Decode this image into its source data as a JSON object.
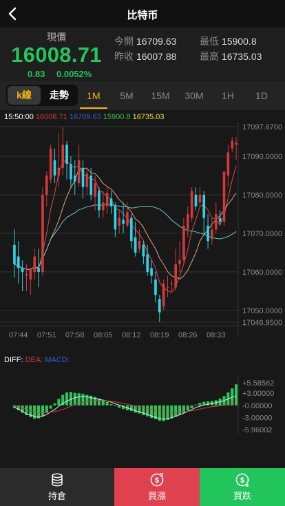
{
  "header": {
    "title": "比特币"
  },
  "quote": {
    "price_label": "現價",
    "price": "16008.71",
    "change": "0.83",
    "change_pct": "0.0052%",
    "stats": [
      {
        "label": "今開",
        "value": "16709.63"
      },
      {
        "label": "最低",
        "value": "15900.8"
      },
      {
        "label": "昨收",
        "value": "16007.88"
      },
      {
        "label": "最高",
        "value": "16735.03"
      }
    ],
    "up_color": "#27c45d"
  },
  "tabs": {
    "kline": "k線",
    "trend": "走勢",
    "intervals": [
      "1M",
      "5M",
      "15M",
      "30M",
      "1H",
      "1D"
    ],
    "active": "1M"
  },
  "candle_info": {
    "time": "15:50:00",
    "close": "16008.71",
    "open": "16709.63",
    "low": "15900.8",
    "high": "16735.03"
  },
  "chart_data": {
    "type": "candlestick",
    "y_ticks": [
      "17097.6700",
      "17090.0000",
      "17080.0000",
      "17070.0000",
      "17060.0000",
      "17050.0000",
      "17046.9500"
    ],
    "ylim": [
      17046.95,
      17097.67
    ],
    "x_ticks": [
      "07:44",
      "07:51",
      "07:58",
      "08:05",
      "08:12",
      "08:19",
      "08:26",
      "08:33"
    ],
    "colors": {
      "up": "#d03a3a",
      "down": "#2ed3e6",
      "ma5": "#d84d4d",
      "ma10": "#e8a07a",
      "ma30": "#6fc3d0"
    },
    "candles": [
      [
        17067.0,
        17062.0,
        17058.5,
        17071.0
      ],
      [
        17064.0,
        17061.0,
        17057.0,
        17068.0
      ],
      [
        17061.0,
        17060.0,
        17055.0,
        17063.0
      ],
      [
        17059.0,
        17059.5,
        17055.0,
        17062.0
      ],
      [
        17058.0,
        17061.0,
        17054.0,
        17061.0
      ],
      [
        17060.0,
        17064.0,
        17058.0,
        17066.0
      ],
      [
        17061.0,
        17060.0,
        17056.0,
        17066.0
      ],
      [
        17060.0,
        17080.0,
        17059.0,
        17082.0
      ],
      [
        17080.0,
        17085.0,
        17077.0,
        17086.0
      ],
      [
        17084.0,
        17092.0,
        17083.0,
        17093.0
      ],
      [
        17089.0,
        17085.0,
        17083.0,
        17092.0
      ],
      [
        17085.0,
        17087.0,
        17082.0,
        17096.0
      ],
      [
        17087.0,
        17093.0,
        17085.0,
        17097.5
      ],
      [
        17093.0,
        17088.0,
        17084.0,
        17094.0
      ],
      [
        17088.0,
        17084.0,
        17082.0,
        17090.0
      ],
      [
        17085.0,
        17083.5,
        17080.0,
        17089.0
      ],
      [
        17083.0,
        17089.0,
        17082.0,
        17093.0
      ],
      [
        17087.0,
        17082.0,
        17079.0,
        17089.0
      ],
      [
        17082.0,
        17085.5,
        17080.0,
        17087.0
      ],
      [
        17085.0,
        17080.0,
        17078.5,
        17087.0
      ],
      [
        17079.5,
        17083.0,
        17076.0,
        17085.0
      ],
      [
        17081.0,
        17076.0,
        17074.0,
        17082.0
      ],
      [
        17076.0,
        17078.0,
        17074.0,
        17081.0
      ],
      [
        17077.0,
        17080.5,
        17075.0,
        17082.0
      ],
      [
        17079.0,
        17077.0,
        17075.0,
        17081.0
      ],
      [
        17077.0,
        17071.0,
        17069.0,
        17078.0
      ],
      [
        17072.0,
        17074.0,
        17070.0,
        17076.0
      ],
      [
        17073.5,
        17072.5,
        17070.0,
        17078.0
      ],
      [
        17072.0,
        17075.5,
        17071.5,
        17078.0
      ],
      [
        17074.0,
        17068.0,
        17066.0,
        17075.0
      ],
      [
        17069.0,
        17065.0,
        17064.0,
        17073.0
      ],
      [
        17066.0,
        17068.0,
        17065.0,
        17071.0
      ],
      [
        17067.0,
        17064.0,
        17062.0,
        17068.0
      ],
      [
        17064.5,
        17060.0,
        17059.0,
        17067.0
      ],
      [
        17061.0,
        17059.0,
        17057.0,
        17063.0
      ],
      [
        17058.0,
        17054.0,
        17052.0,
        17060.0
      ],
      [
        17053.0,
        17049.5,
        17047.0,
        17054.0
      ],
      [
        17051.0,
        17057.0,
        17050.0,
        17058.0
      ],
      [
        17056.0,
        17056.0,
        17053.5,
        17059.0
      ],
      [
        17057.0,
        17057.0,
        17055.0,
        17058.0
      ],
      [
        17056.0,
        17062.0,
        17055.0,
        17066.0
      ],
      [
        17062.0,
        17063.0,
        17060.0,
        17068.0
      ],
      [
        17063.0,
        17072.0,
        17062.0,
        17074.0
      ],
      [
        17071.0,
        17075.0,
        17069.0,
        17077.0
      ],
      [
        17074.0,
        17081.0,
        17073.0,
        17082.0
      ],
      [
        17080.0,
        17077.0,
        17076.0,
        17082.0
      ],
      [
        17078.0,
        17080.0,
        17077.0,
        17082.0
      ],
      [
        17080.0,
        17074.0,
        17070.0,
        17081.0
      ],
      [
        17072.0,
        17068.0,
        17066.0,
        17075.0
      ],
      [
        17068.5,
        17071.0,
        17067.0,
        17074.0
      ],
      [
        17071.0,
        17075.0,
        17070.0,
        17078.0
      ],
      [
        17074.0,
        17073.0,
        17072.0,
        17076.0
      ],
      [
        17073.0,
        17086.0,
        17072.0,
        17086.0
      ],
      [
        17085.0,
        17091.0,
        17082.0,
        17093.0
      ],
      [
        17092.0,
        17094.0,
        17091.0,
        17095.0
      ],
      [
        17093.0,
        17093.5,
        17089.0,
        17095.0
      ]
    ],
    "macd": {
      "legend": [
        "DIFF:",
        "DEA:",
        "MACD:"
      ],
      "legend_colors": [
        "#ffffff",
        "#d03a3a",
        "#2f5fd8"
      ],
      "y_ticks": [
        "+5.58562",
        "+3.00000",
        "-0.00000",
        "-3.00000",
        "-5.96002"
      ],
      "ylim": [
        -5.96002,
        5.58562
      ],
      "histogram": [
        -0.6,
        -1.2,
        -1.8,
        -2.4,
        -2.9,
        -3.3,
        -3.2,
        -2.6,
        -1.8,
        -0.8,
        0.5,
        1.6,
        2.6,
        3.2,
        3.3,
        3.1,
        3.0,
        2.9,
        2.6,
        2.4,
        2.1,
        1.7,
        1.4,
        0.9,
        0.3,
        -0.2,
        -0.6,
        -0.9,
        -1.2,
        -1.4,
        -1.8,
        -2.0,
        -2.4,
        -2.7,
        -3.1,
        -3.4,
        -3.8,
        -3.9,
        -3.6,
        -3.2,
        -2.8,
        -2.3,
        -1.8,
        -1.3,
        -0.7,
        0.2,
        0.6,
        0.9,
        1.0,
        1.1,
        1.3,
        1.7,
        2.3,
        3.2,
        4.2,
        5.2
      ],
      "diff": [
        -0.5,
        -0.9,
        -1.5,
        -2.1,
        -2.4,
        -2.7,
        -2.9,
        -2.7,
        -2.2,
        -1.6,
        -1.0,
        -0.2,
        0.5,
        1.1,
        1.5,
        1.9,
        2.1,
        2.2,
        2.1,
        1.9,
        1.7,
        1.5,
        1.3,
        1.1,
        0.8,
        0.4,
        0.1,
        -0.3,
        -0.6,
        -0.9,
        -1.3,
        -1.6,
        -1.9,
        -2.2,
        -2.6,
        -2.9,
        -3.3,
        -3.4,
        -3.3,
        -3.0,
        -2.7,
        -2.3,
        -1.9,
        -1.5,
        -1.0,
        -0.5,
        -0.2,
        0.1,
        0.3,
        0.5,
        0.7,
        0.9,
        1.2,
        1.6,
        2.0,
        2.4
      ],
      "dea": [
        -0.2,
        -0.4,
        -0.7,
        -1.0,
        -1.3,
        -1.5,
        -1.7,
        -1.8,
        -1.8,
        -1.7,
        -1.5,
        -1.3,
        -1.0,
        -0.6,
        -0.2,
        0.2,
        0.5,
        0.8,
        1.0,
        1.1,
        1.2,
        1.2,
        1.2,
        1.1,
        1.0,
        0.9,
        0.7,
        0.5,
        0.3,
        0.1,
        -0.2,
        -0.4,
        -0.6,
        -0.8,
        -1.0,
        -1.2,
        -1.4,
        -1.6,
        -1.7,
        -1.8,
        -1.8,
        -1.7,
        -1.6,
        -1.5,
        -1.3,
        -1.1,
        -0.9,
        -0.7,
        -0.5,
        -0.3,
        -0.2,
        -0.1,
        0.0,
        0.2,
        0.4,
        0.6
      ]
    }
  },
  "bottom_nav": [
    {
      "label": "持倉",
      "bg": "#2b2b2b"
    },
    {
      "label": "買漲",
      "bg": "#e0414f"
    },
    {
      "label": "買跌",
      "bg": "#22c45c"
    }
  ]
}
